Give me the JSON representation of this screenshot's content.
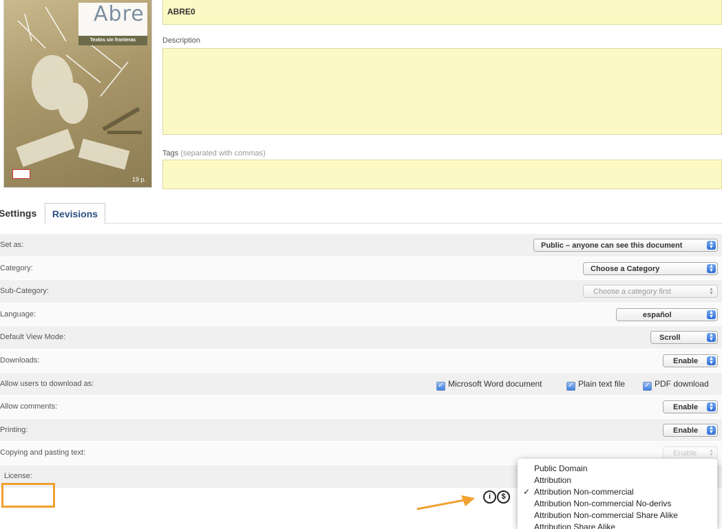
{
  "document": {
    "thumb_title": "Abre",
    "thumb_subtitle": "Textos sin fronteras",
    "thumb_pages": "19 p.",
    "title_value": "ABRE0",
    "description_label": "Description",
    "tags_label": "Tags",
    "tags_hint": "(separated with commas)"
  },
  "tabs": [
    {
      "label": "Settings"
    },
    {
      "label": "Revisions"
    }
  ],
  "settings": {
    "set_as": {
      "label": "Set as:",
      "value": "Public – anyone can see this document"
    },
    "category": {
      "label": "Category:",
      "value": "Choose a Category"
    },
    "subcategory": {
      "label": "Sub-Category:",
      "value": "Choose a category first"
    },
    "language": {
      "label": "Language:",
      "value": "español"
    },
    "view_mode": {
      "label": "Default View Mode:",
      "value": "Scroll"
    },
    "downloads": {
      "label": "Downloads:",
      "value": "Enable"
    },
    "download_as": {
      "label": "Allow users to download as:",
      "options": [
        "Microsoft Word document",
        "Plain text file",
        "PDF download"
      ]
    },
    "comments": {
      "label": "Allow comments:",
      "value": "Enable"
    },
    "printing": {
      "label": "Printing:",
      "value": "Enable"
    },
    "copy_paste": {
      "label": "Copying and pasting text:",
      "value": "Enable"
    },
    "license": {
      "label": "License:"
    }
  },
  "license_menu": {
    "items": [
      {
        "label": "Public Domain",
        "checked": false
      },
      {
        "label": "Attribution",
        "checked": false
      },
      {
        "label": "Attribution Non-commercial",
        "checked": true
      },
      {
        "label": "Attribution Non-commercial No-derivs",
        "checked": false
      },
      {
        "label": "Attribution Non-commercial Share Alike",
        "checked": false
      },
      {
        "label": "Attribution Share Alike",
        "checked": false
      }
    ],
    "check_glyph": "✓"
  },
  "colors": {
    "field_bg": "#fcf9c4",
    "highlight": "#f0a030",
    "tab_link": "#2b4f82"
  }
}
